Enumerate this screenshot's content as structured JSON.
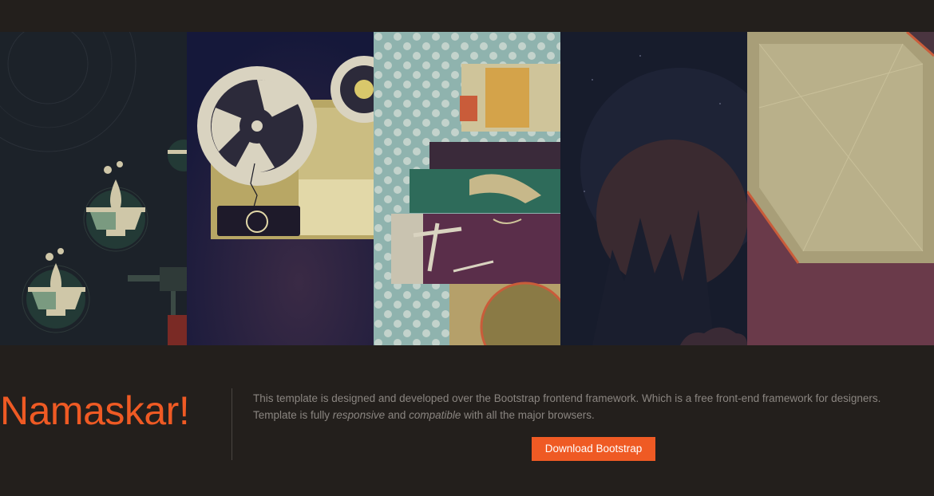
{
  "intro": {
    "heading": "Namaskar!",
    "line1": "This template is designed and developed over the Bootstrap frontend framework. Which is a free front-end framework for designers.",
    "line2_pre": "Template is fully ",
    "line2_em1": "responsive",
    "line2_mid": " and ",
    "line2_em2": "compatible",
    "line2_post": " with all the major browsers.",
    "button_label": "Download Bootstrap"
  },
  "colors": {
    "background": "#231f1c",
    "accent": "#ef5a24",
    "text": "#8a8580"
  },
  "gallery": {
    "panels": [
      {
        "name": "oil-lamps-illustration"
      },
      {
        "name": "film-projector-illustration"
      },
      {
        "name": "collage-illustration"
      },
      {
        "name": "planet-landscape-illustration"
      },
      {
        "name": "abstract-frame-illustration"
      }
    ]
  }
}
